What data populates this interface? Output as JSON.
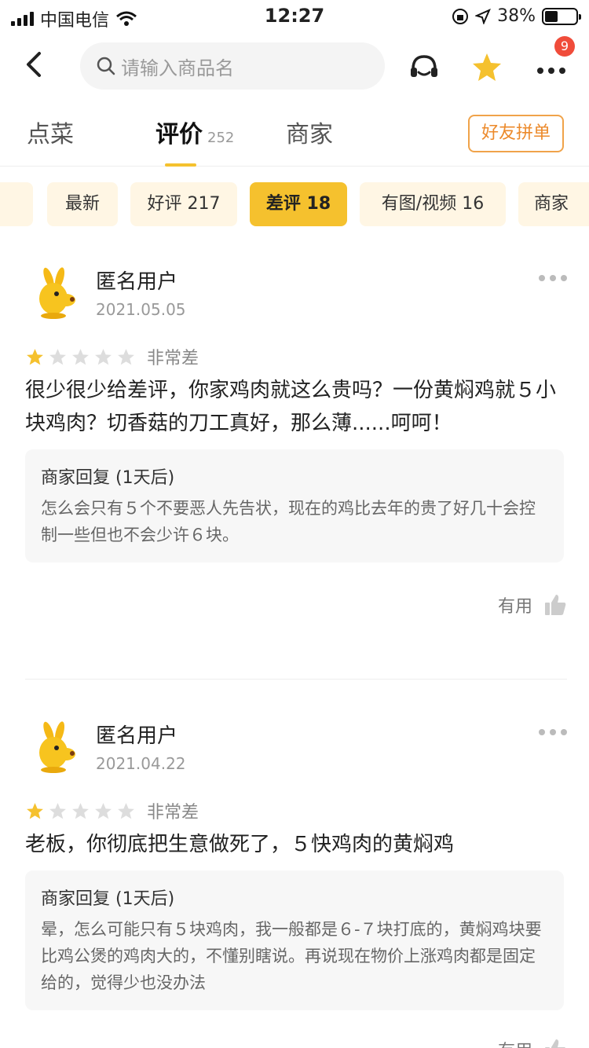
{
  "status_bar": {
    "carrier": "中国电信",
    "time": "12:27",
    "battery_percent": "38%"
  },
  "nav": {
    "search_placeholder": "请输入商品名",
    "badge_count": "9",
    "icons": [
      "back-icon",
      "search-icon",
      "customer-service-icon",
      "star-icon",
      "more-icon"
    ]
  },
  "tabs": {
    "items": [
      {
        "label": "点菜"
      },
      {
        "label": "评价",
        "count": "252"
      },
      {
        "label": "商家"
      }
    ],
    "group_order_label": "好友拼单"
  },
  "filters": {
    "items": [
      {
        "label": "最新"
      },
      {
        "label": "好评 217"
      },
      {
        "label": "差评 18"
      },
      {
        "label": "有图/视频 16"
      },
      {
        "label": "商家"
      }
    ],
    "active": "差评 18"
  },
  "reviews": [
    {
      "user": "匿名用户",
      "date": "2021.05.05",
      "stars": 1,
      "rating_text": "非常差",
      "content": "很少很少给差评，你家鸡肉就这么贵吗？一份黄焖鸡就５小块鸡肉？切香菇的刀工真好，那么薄......呵呵！",
      "reply_title": "商家回复 (1天后)",
      "reply_text": "怎么会只有５个不要恶人先告状，现在的鸡比去年的贵了好几十会控制一些但也不会少许６块。",
      "useful_label": "有用"
    },
    {
      "user": "匿名用户",
      "date": "2021.04.22",
      "stars": 1,
      "rating_text": "非常差",
      "content": "老板，你彻底把生意做死了，５快鸡肉的黄焖鸡",
      "reply_title": "商家回复 (1天后)",
      "reply_text": "晕，怎么可能只有５块鸡肉，我一般都是６-７块打底的，黄焖鸡块要比鸡公煲的鸡肉大的，不懂别瞎说。再说现在物价上涨鸡肉都是固定给的，觉得少也没办法",
      "useful_label": "有用"
    }
  ],
  "colors": {
    "accent": "#f5c12e",
    "chip_bg": "#fff6e4",
    "badge": "#f04c3a",
    "orange": "#ec8a2b"
  }
}
